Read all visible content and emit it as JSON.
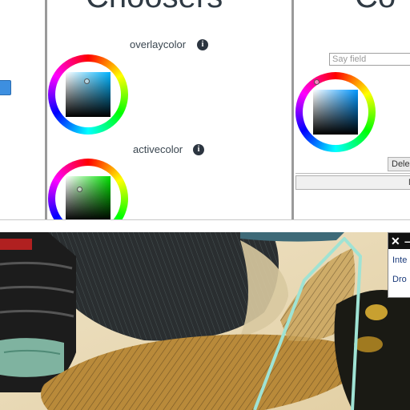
{
  "panels": {
    "middle": {
      "heading": "Choosers",
      "properties": [
        {
          "label": "overlaycolor",
          "info_icon": "info-icon",
          "square_color": "#00b4ff"
        },
        {
          "label": "activecolor",
          "info_icon": "info-icon",
          "square_color": "#00e000"
        }
      ]
    },
    "right": {
      "heading": "Co",
      "text_field": {
        "value": "",
        "placeholder": "Say field"
      },
      "buttons": [
        "Dele",
        "Ne"
      ],
      "square_color": "#0096ff"
    }
  },
  "overlay": {
    "close_icon": "✕",
    "minimize_icon": "–",
    "lines": [
      "Inte",
      "Dro"
    ]
  },
  "colors": {
    "panel_border": "#9a9a9a",
    "selection_stroke": "#9fe3d4",
    "overlay_bar": "#111111"
  }
}
